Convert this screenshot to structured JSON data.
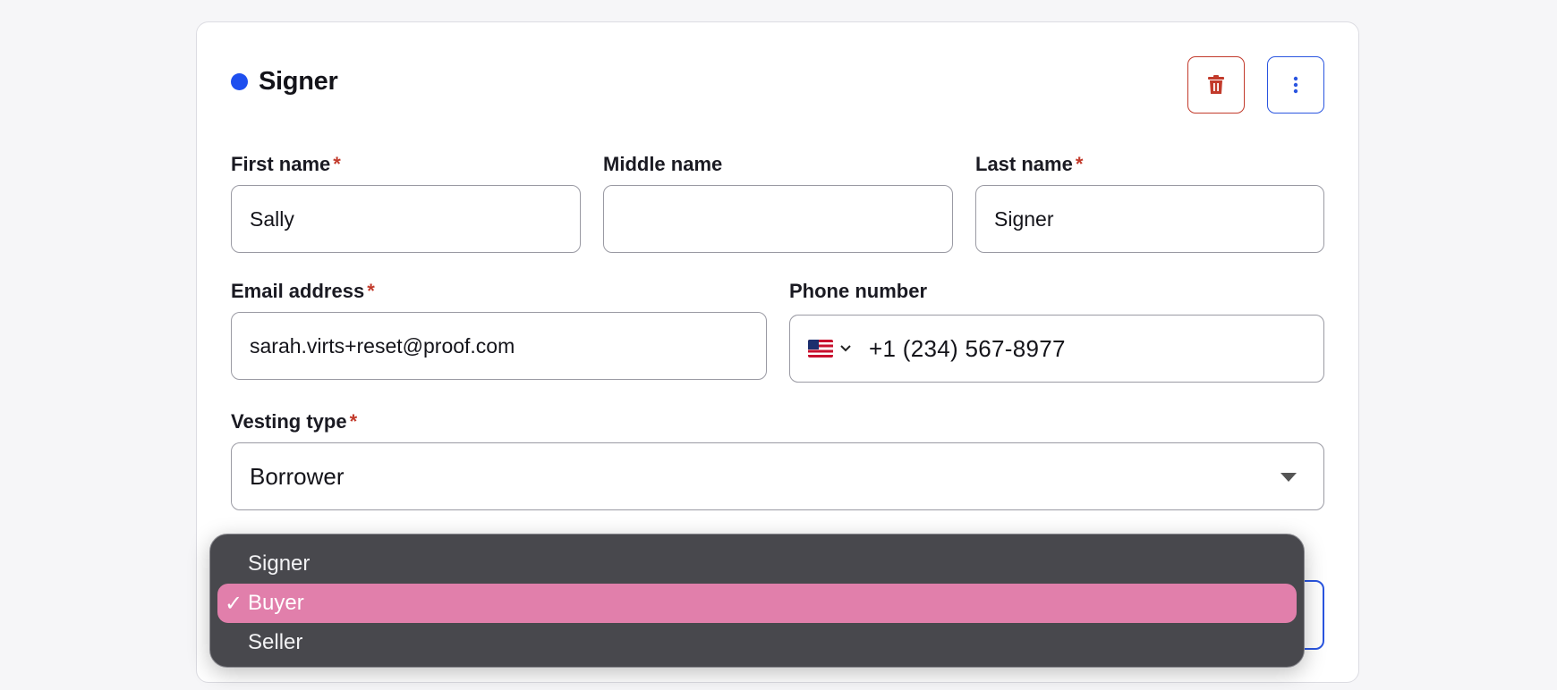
{
  "section": {
    "title": "Signer",
    "accent_color": "#1e4fef",
    "delete_icon": "trash-icon",
    "more_icon": "more-vertical-icon"
  },
  "fields": {
    "first_name": {
      "label": "First name",
      "required_mark": "*",
      "value": "Sally"
    },
    "middle_name": {
      "label": "Middle name",
      "value": ""
    },
    "last_name": {
      "label": "Last name",
      "required_mark": "*",
      "value": "Signer"
    },
    "email": {
      "label": "Email address",
      "required_mark": "*",
      "value": "sarah.virts+reset@proof.com"
    },
    "phone": {
      "label": "Phone number",
      "country_flag_icon": "us-flag-icon",
      "chevron": "⌄",
      "value": "+1 (234) 567-8977"
    },
    "vesting_type": {
      "label": "Vesting type",
      "required_mark": "*",
      "value": "Borrower"
    }
  },
  "dropdown": {
    "options": [
      {
        "label": "Signer",
        "selected": false
      },
      {
        "label": "Buyer",
        "selected": true,
        "check": "✓"
      },
      {
        "label": "Seller",
        "selected": false
      }
    ],
    "highlight_color": "#e17fab"
  }
}
